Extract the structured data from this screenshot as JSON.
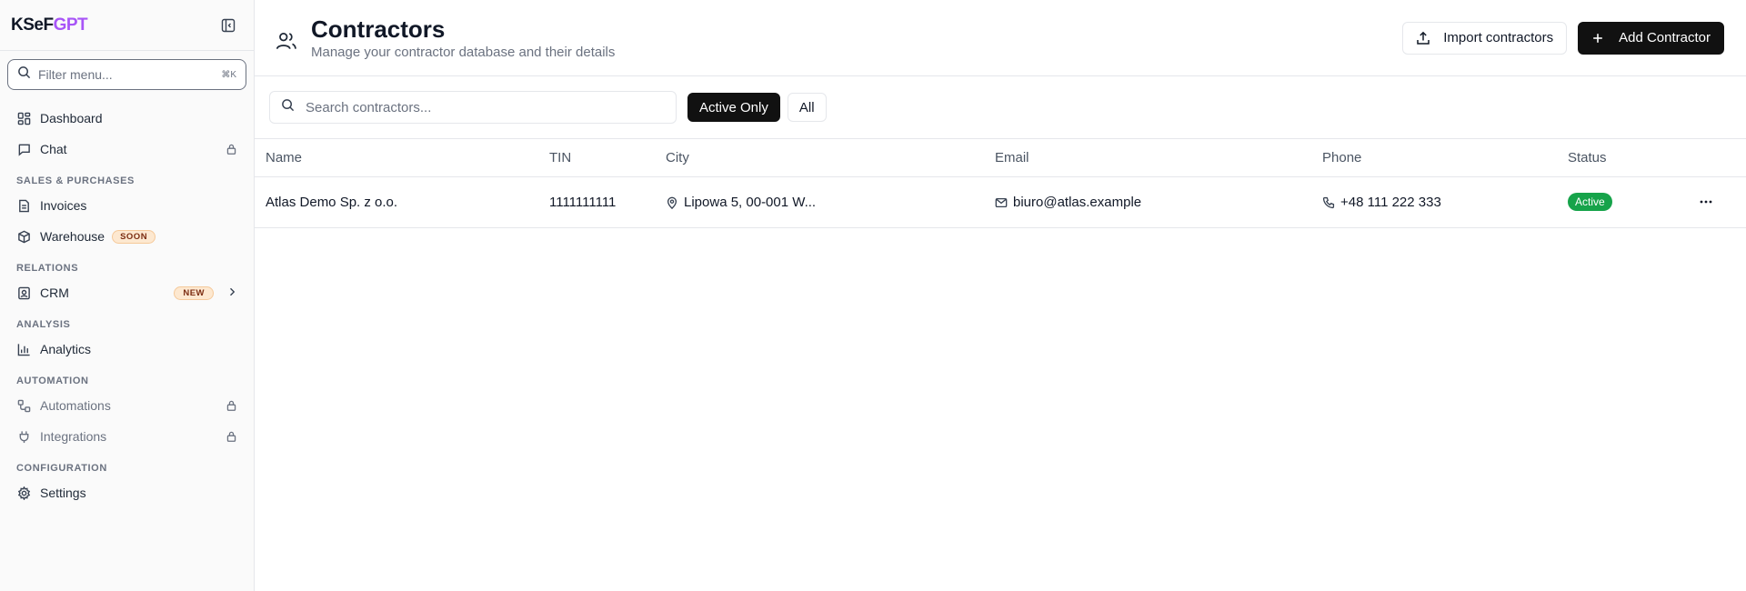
{
  "sidebar": {
    "logo_part1": "KSeF",
    "logo_part2": "GPT",
    "filter_placeholder": "Filter menu...",
    "filter_shortcut": "⌘K",
    "items": {
      "dashboard": "Dashboard",
      "chat": "Chat",
      "invoices": "Invoices",
      "warehouse": "Warehouse",
      "warehouse_badge": "SOON",
      "crm": "CRM",
      "crm_badge": "NEW",
      "analytics": "Analytics",
      "automations": "Automations",
      "integrations": "Integrations",
      "settings": "Settings"
    },
    "sections": {
      "sales": "SALES & PURCHASES",
      "relations": "RELATIONS",
      "analysis": "ANALYSIS",
      "automation": "AUTOMATION",
      "configuration": "CONFIGURATION"
    }
  },
  "header": {
    "title": "Contractors",
    "subtitle": "Manage your contractor database and their details",
    "import_label": "Import contractors",
    "add_label": "Add Contractor"
  },
  "toolbar": {
    "search_placeholder": "Search contractors...",
    "filter_active": "Active Only",
    "filter_all": "All"
  },
  "table": {
    "columns": {
      "name": "Name",
      "tin": "TIN",
      "city": "City",
      "email": "Email",
      "phone": "Phone",
      "status": "Status"
    },
    "rows": [
      {
        "name": "Atlas Demo Sp. z o.o.",
        "tin": "1111111111",
        "city": "Lipowa 5, 00-001 W...",
        "email": "biuro@atlas.example",
        "phone": "+48 111 222 333",
        "status": "Active"
      }
    ]
  },
  "colors": {
    "accent": "#a855f7",
    "primary_button": "#111111",
    "status_active": "#16a34a",
    "badge_bg": "#fde8d0"
  }
}
